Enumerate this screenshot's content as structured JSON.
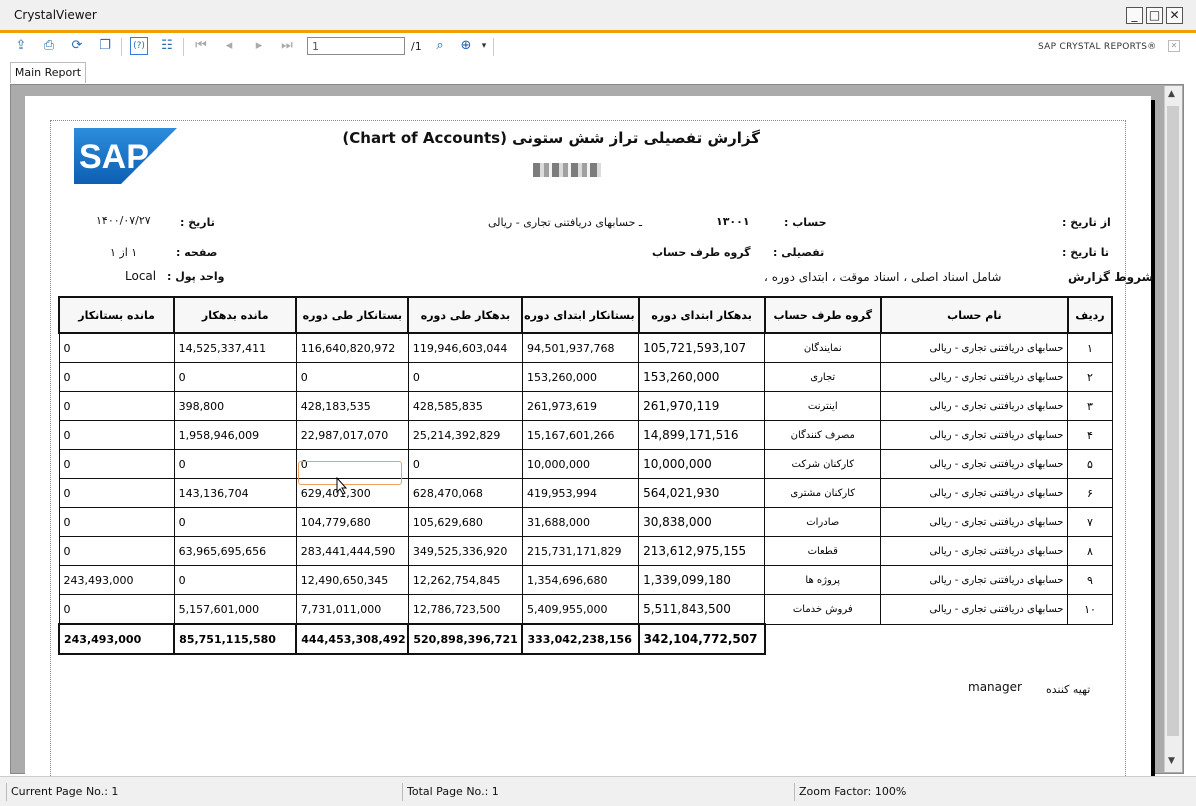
{
  "window": {
    "title": "CrystalViewer"
  },
  "toolbar": {
    "page_value": "1",
    "page_total": "/1",
    "brand": "SAP CRYSTAL REPORTS®"
  },
  "tabs": {
    "main": "Main Report"
  },
  "report": {
    "title": "گزارش تفصیلی تراز شش ستونی (Chart of Accounts)",
    "from_date_label": "از تاریخ :",
    "to_date_label": "تا تاریخ :",
    "conditions_label": "شروط گزارش",
    "conditions_value": "شامل  اسناد اصلی ، اسناد موقت ، ابتدای دوره ،",
    "account_label": "حساب :",
    "account_code": "۱۳۰۰۱",
    "account_name": "ـ حسابهای دریافتنی تجاری - ریالی",
    "detail_label": "تفصیلی :",
    "detail_value": "گروه طرف حساب",
    "date_label": "تاریخ :",
    "date_value": "۱۴۰۰/۰۷/۲۷",
    "page_label": "صفحه :",
    "page_value": "۱  از  ۱",
    "currency_label": "واحد پول :",
    "currency_value": "Local",
    "prepared_label": "تهیه کننده",
    "prepared_value": "manager"
  },
  "table": {
    "headers": [
      "ردیف",
      "نام حساب",
      "گروه طرف حساب",
      "بدهکار ابتدای دوره",
      "بستانکار ابتدای دوره",
      "بدهکار طی دوره",
      "بستانکار طی دوره",
      "مانده بدهکار",
      "مانده بستانکار"
    ],
    "rows": [
      [
        "۱",
        "حسابهای دریافتنی تجاری - ریالی",
        "نمایندگان",
        "105,721,593,107",
        "94,501,937,768",
        "119,946,603,044",
        "116,640,820,972",
        "14,525,337,411",
        "0"
      ],
      [
        "۲",
        "حسابهای دریافتنی تجاری - ریالی",
        "تجاری",
        "153,260,000",
        "153,260,000",
        "0",
        "0",
        "0",
        "0"
      ],
      [
        "۳",
        "حسابهای دریافتنی تجاری - ریالی",
        "اینترنت",
        "261,970,119",
        "261,973,619",
        "428,585,835",
        "428,183,535",
        "398,800",
        "0"
      ],
      [
        "۴",
        "حسابهای دریافتنی تجاری - ریالی",
        "مصرف کنندگان",
        "14,899,171,516",
        "15,167,601,266",
        "25,214,392,829",
        "22,987,017,070",
        "1,958,946,009",
        "0"
      ],
      [
        "۵",
        "حسابهای دریافتنی تجاری - ریالی",
        "کارکنان شرکت",
        "10,000,000",
        "10,000,000",
        "0",
        "0",
        "0",
        "0"
      ],
      [
        "۶",
        "حسابهای دریافتنی تجاری - ریالی",
        "کارکنان مشتری",
        "564,021,930",
        "419,953,994",
        "628,470,068",
        "629,401,300",
        "143,136,704",
        "0"
      ],
      [
        "۷",
        "حسابهای دریافتنی تجاری - ریالی",
        "صادرات",
        "30,838,000",
        "31,688,000",
        "105,629,680",
        "104,779,680",
        "0",
        "0"
      ],
      [
        "۸",
        "حسابهای دریافتنی تجاری - ریالی",
        "قطعات",
        "213,612,975,155",
        "215,731,171,829",
        "349,525,336,920",
        "283,441,444,590",
        "63,965,695,656",
        "0"
      ],
      [
        "۹",
        "حسابهای دریافتنی تجاری - ریالی",
        "پروژه ها",
        "1,339,099,180",
        "1,354,696,680",
        "12,262,754,845",
        "12,490,650,345",
        "0",
        "243,493,000"
      ],
      [
        "۱۰",
        "حسابهای دریافتنی تجاری - ریالی",
        "فروش خدمات",
        "5,511,843,500",
        "5,409,955,000",
        "12,786,723,500",
        "7,731,011,000",
        "5,157,601,000",
        "0"
      ]
    ],
    "totals": [
      "342,104,772,507",
      "333,042,238,156",
      "520,898,396,721",
      "444,453,308,492",
      "85,751,115,580",
      "243,493,000"
    ]
  },
  "status": {
    "current_page": "Current Page No.: 1",
    "total_page": "Total Page No.: 1",
    "zoom": "Zoom Factor: 100%"
  },
  "colors": {
    "accent": "#f0a000",
    "sap_blue": "#1a73c9"
  }
}
